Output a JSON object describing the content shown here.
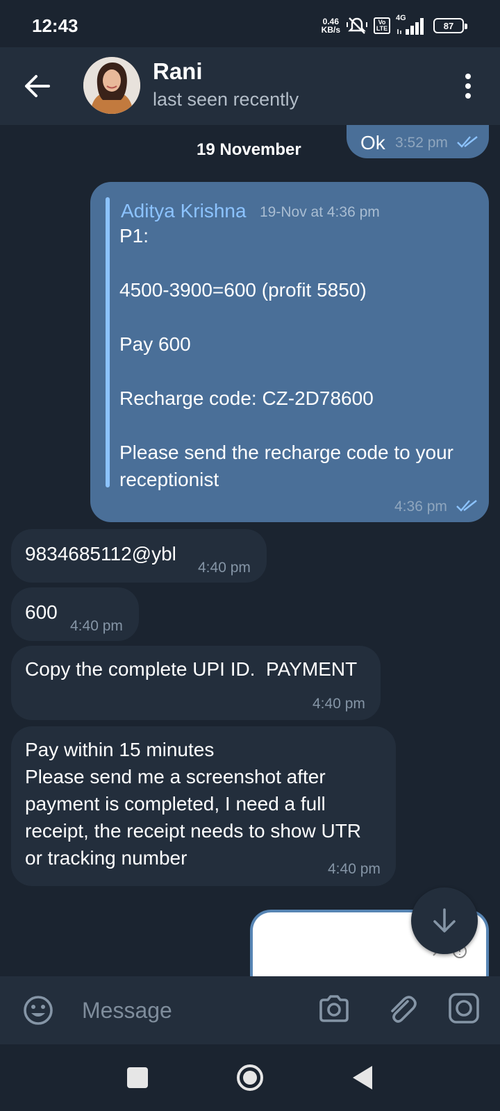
{
  "status_bar": {
    "time": "12:43",
    "net_speed_value": "0.46",
    "net_speed_unit": "KB/s",
    "volte_top": "Vo",
    "volte_bottom": "LTE",
    "network": "4G",
    "battery": "87"
  },
  "header": {
    "name": "Rani",
    "status": "last seen recently"
  },
  "date_separator": "19 November",
  "messages": [
    {
      "text": "Ok",
      "time": "3:52 pm"
    },
    {
      "reply_author": "Aditya Krishna",
      "reply_time": "19-Nov at 4:36 pm",
      "text": "P1:\n\n4500-3900=600 (profit 5850)\n\nPay 600\n\nRecharge code: CZ-2D78600\n\nPlease send the recharge code to your receptionist",
      "time": "4:36 pm"
    },
    {
      "text": "9834685112@ybl",
      "time": "4:40 pm"
    },
    {
      "text": "600",
      "time": "4:40 pm"
    },
    {
      "text": "Copy the complete UPI ID.  PAYMENT",
      "time": "4:40 pm"
    },
    {
      "text": "Pay within 15 minutes\nPlease send me a screenshot after\npayment is completed, I need a full\nreceipt, the receipt needs to show UTR\nor tracking number",
      "time": "4:40 pm"
    }
  ],
  "input": {
    "placeholder": "Message"
  },
  "colors": {
    "background": "#1b2430",
    "header": "#232e3c",
    "outgoing_bubble": "#4a6f98",
    "incoming_bubble": "#232e3c",
    "accent": "#8cc3ff"
  },
  "icons": [
    "back-arrow-icon",
    "more-vertical-icon",
    "double-check-icon",
    "arrow-down-icon",
    "emoji-icon",
    "camera-icon",
    "paperclip-icon",
    "video-message-icon"
  ]
}
